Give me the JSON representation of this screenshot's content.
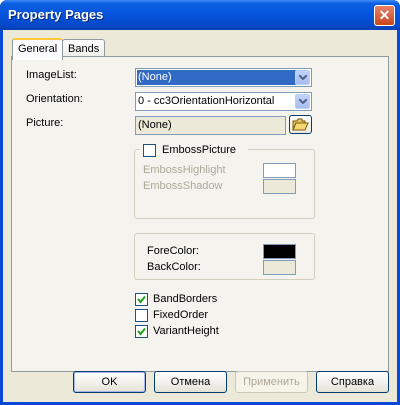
{
  "window": {
    "title": "Property Pages",
    "close_glyph": "✕"
  },
  "tabs": [
    {
      "label": "General"
    },
    {
      "label": "Bands"
    }
  ],
  "general": {
    "imagelist_label": "ImageList:",
    "imagelist_value": "(None)",
    "orientation_label": "Orientation:",
    "orientation_value": "0 - cc3OrientationHorizontal",
    "picture_label": "Picture:",
    "picture_value": "(None)",
    "emboss_picture_label": "EmbossPicture",
    "emboss_highlight_label": "EmbossHighlight",
    "emboss_shadow_label": "EmbossShadow",
    "forecolor_label": "ForeColor:",
    "backcolor_label": "BackColor:",
    "band_borders_label": "BandBorders",
    "fixed_order_label": "FixedOrder",
    "variant_height_label": "VariantHeight",
    "emboss_picture_checked": false,
    "band_borders_checked": true,
    "fixed_order_checked": false,
    "variant_height_checked": true,
    "forecolor": "#000000",
    "backcolor": "#ECE9D8",
    "emboss_highlight_color": "#FFFFFF",
    "emboss_shadow_color": "#ECE9D8"
  },
  "buttons": {
    "ok": "OK",
    "cancel": "Отмена",
    "apply": "Применить",
    "help": "Справка"
  },
  "colors": {
    "titlebar": "#0553DC",
    "dialog_bg": "#ECE9D8",
    "selection": "#316AC5"
  }
}
